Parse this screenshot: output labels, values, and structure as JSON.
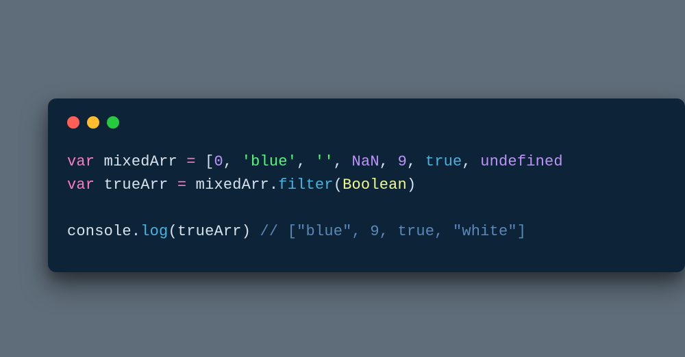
{
  "code": {
    "line1": {
      "kw": "var",
      "varname": "mixedArr",
      "eq": " = ",
      "lbracket": "[",
      "n0": "0",
      "c1": ", ",
      "s_blue": "'blue'",
      "c2": ", ",
      "s_empty": "''",
      "c3": ", ",
      "nan": "NaN",
      "c4": ", ",
      "n9": "9",
      "c5": ", ",
      "true": "true",
      "c6": ", ",
      "undef": "undefined"
    },
    "line2": {
      "kw": "var",
      "varname": "trueArr",
      "eq": " = ",
      "obj": "mixedArr",
      "dot": ".",
      "method": "filter",
      "lparen": "(",
      "arg": "Boolean",
      "rparen": ")"
    },
    "line4": {
      "obj": "console",
      "dot": ".",
      "method": "log",
      "lparen": "(",
      "arg": "trueArr",
      "rparen": ")",
      "space": " ",
      "comment": "// [\"blue\", 9, true, \"white\"]"
    }
  }
}
